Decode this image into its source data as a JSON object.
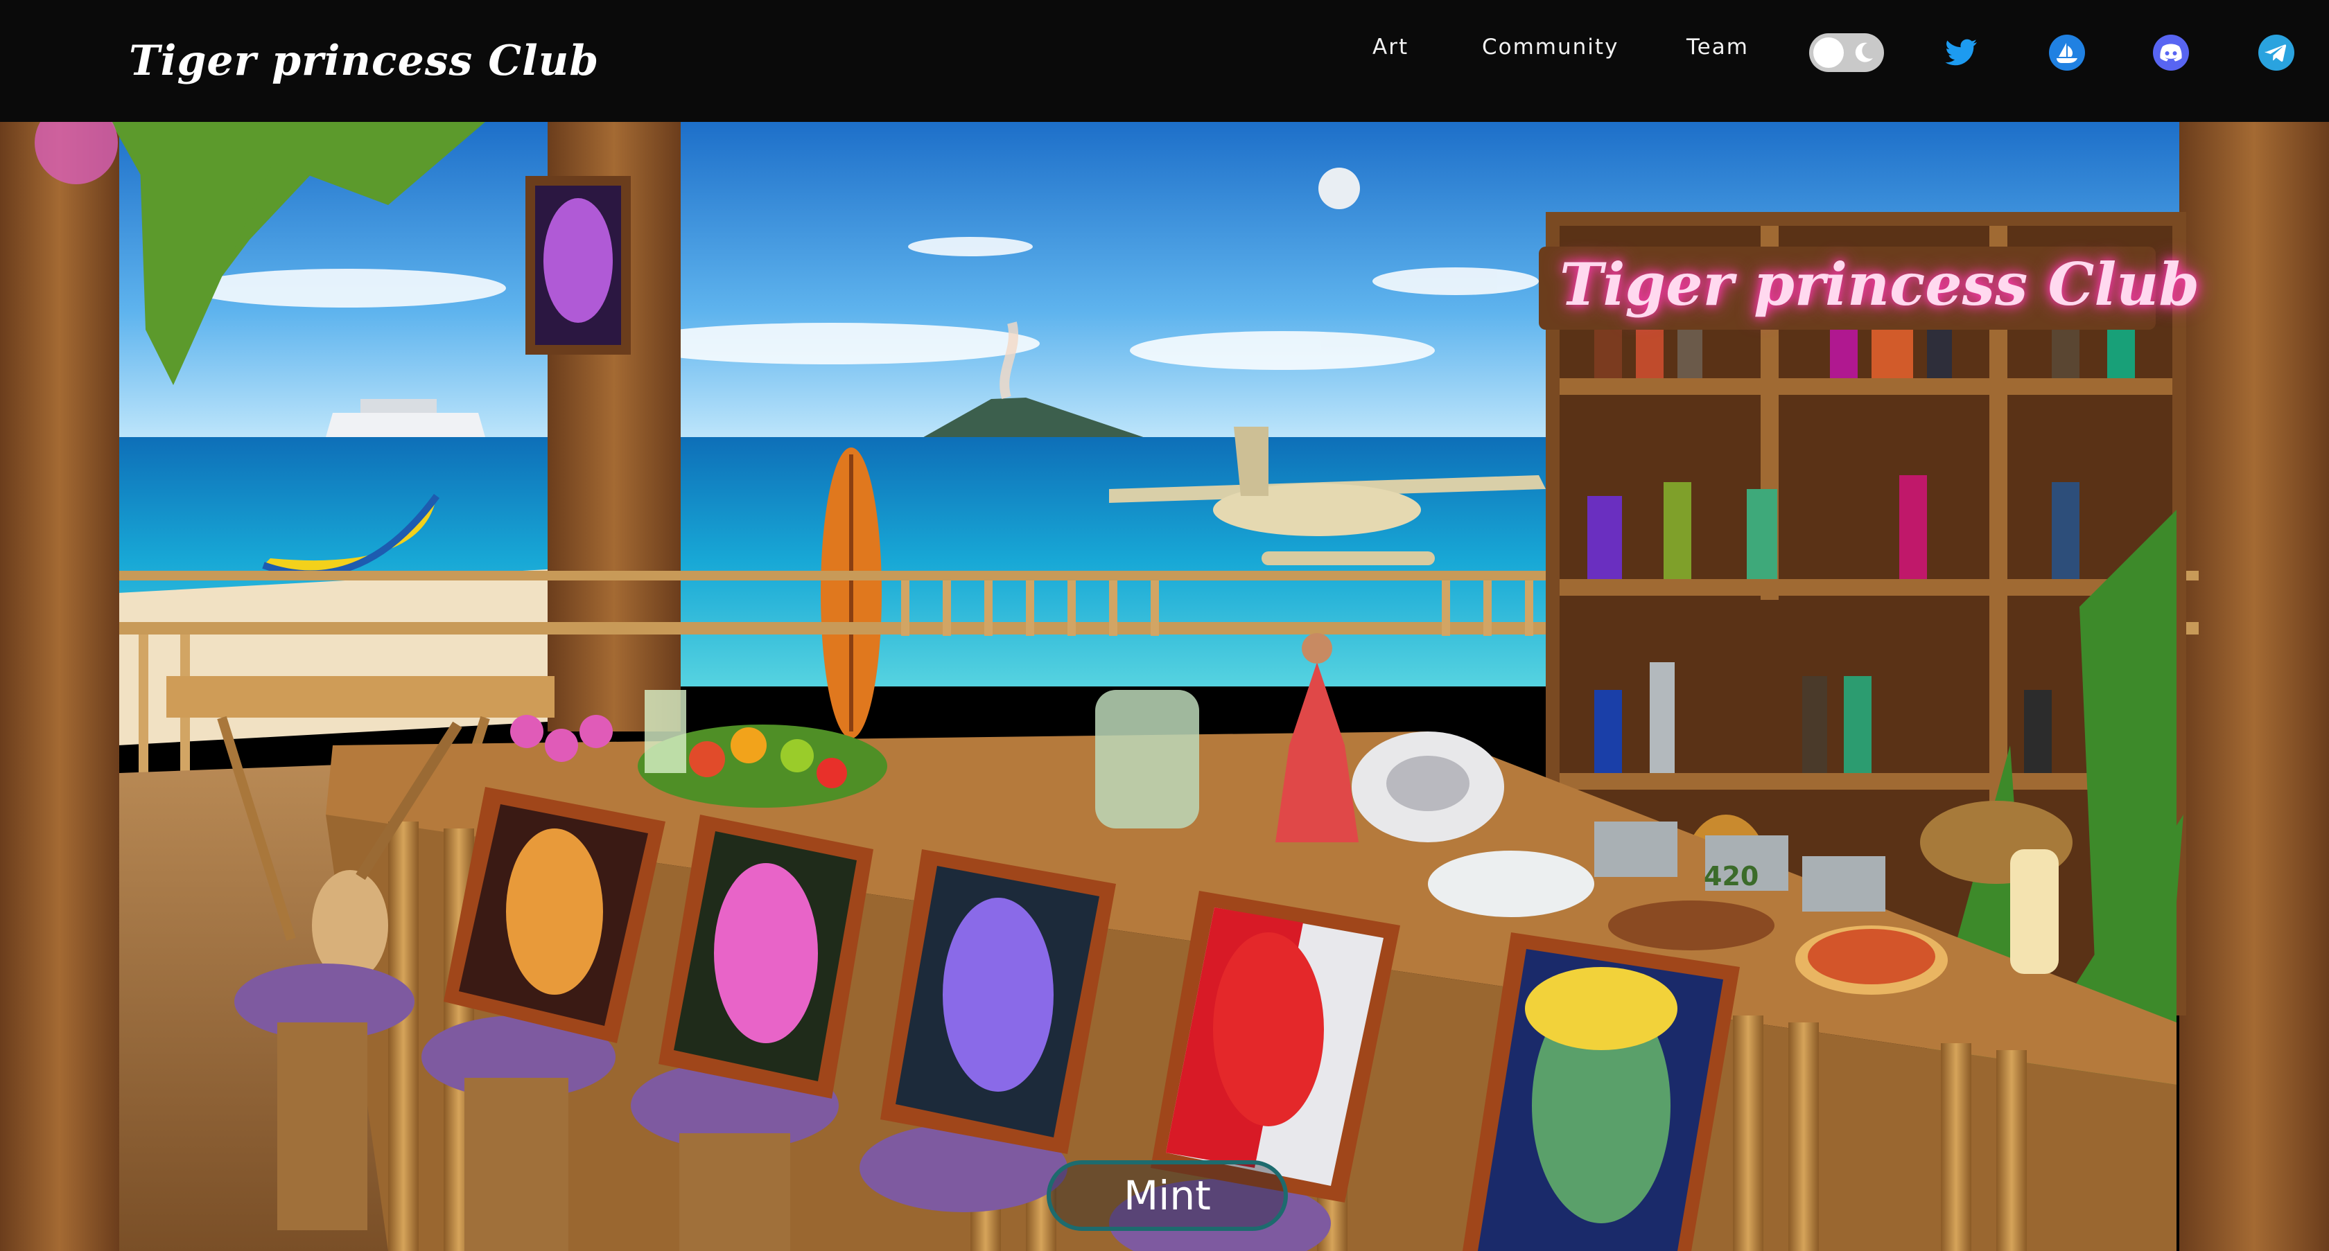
{
  "brand": {
    "logo_text": "Tiger princess Club"
  },
  "nav": {
    "links": [
      {
        "label": "Art"
      },
      {
        "label": "Community"
      },
      {
        "label": "Team"
      }
    ],
    "theme_toggle": {
      "state": "light",
      "icon": "moon-icon"
    },
    "socials": [
      {
        "icon": "twitter-icon",
        "color": "#1d9bf0"
      },
      {
        "icon": "opensea-icon",
        "color": "#2081e2"
      },
      {
        "icon": "discord-icon",
        "color": "#5865f2"
      },
      {
        "icon": "telegram-icon",
        "color": "#2aa3df"
      }
    ]
  },
  "scene": {
    "sign_text": "Tiger princess Club",
    "jar_label": "420",
    "mint_label": "Mint"
  },
  "colors": {
    "nav_bg": "#0a0a0a",
    "mint_border": "#1d6b6e",
    "sign_glow": "#ff3ab0"
  }
}
